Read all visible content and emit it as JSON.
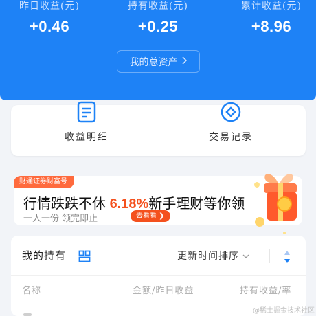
{
  "header": {
    "stats": [
      {
        "label": "昨日收益(元)",
        "value": "+0.46"
      },
      {
        "label": "持有收益(元)",
        "value": "+0.25"
      },
      {
        "label": "累计收益(元)",
        "value": "+8.96"
      }
    ],
    "assets_button": "我的总资产"
  },
  "quick_actions": [
    {
      "label": "收益明细",
      "icon": "document-icon"
    },
    {
      "label": "交易记录",
      "icon": "diamond-circle-icon"
    }
  ],
  "banner": {
    "tag": "财通证券财富号",
    "title_pre": "行情跌跌不休 ",
    "title_pct": "6.18%",
    "title_post": "新手理财等你领",
    "subtitle": "一人一份 领完即止",
    "button": "去看看 ❯"
  },
  "holdings": {
    "title": "我的持有",
    "sort_label": "更新时间排序",
    "columns": [
      "名称",
      "金额/昨日收益",
      "持有收益/率"
    ]
  },
  "watermark": "@稀土掘金技术社区",
  "colors": {
    "primary": "#1e82f6",
    "accent": "#f4511e"
  }
}
